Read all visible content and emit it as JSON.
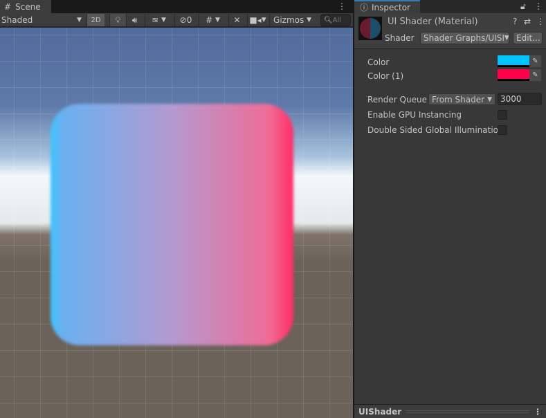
{
  "scene": {
    "tab_label": "Scene",
    "shading_mode": "Shaded",
    "btn_2d": "2D",
    "hidden_count": "0",
    "gizmos_label": "Gizmos",
    "search_placeholder": "All"
  },
  "inspector": {
    "tab_label": "Inspector",
    "material_title": "UI Shader (Material)",
    "shader_label": "Shader",
    "shader_value": "Shader Graphs/UISI",
    "edit_label": "Edit...",
    "properties": [
      {
        "label": "Color",
        "color": "#00c3ff"
      },
      {
        "label": "Color (1)",
        "color": "#ff004b"
      }
    ],
    "render_queue_label": "Render Queue",
    "render_queue_mode": "From Shader",
    "render_queue_value": "3000",
    "gpu_instancing_label": "Enable GPU Instancing",
    "double_sided_label": "Double Sided Global Illumination",
    "footer_label": "UIShader"
  }
}
